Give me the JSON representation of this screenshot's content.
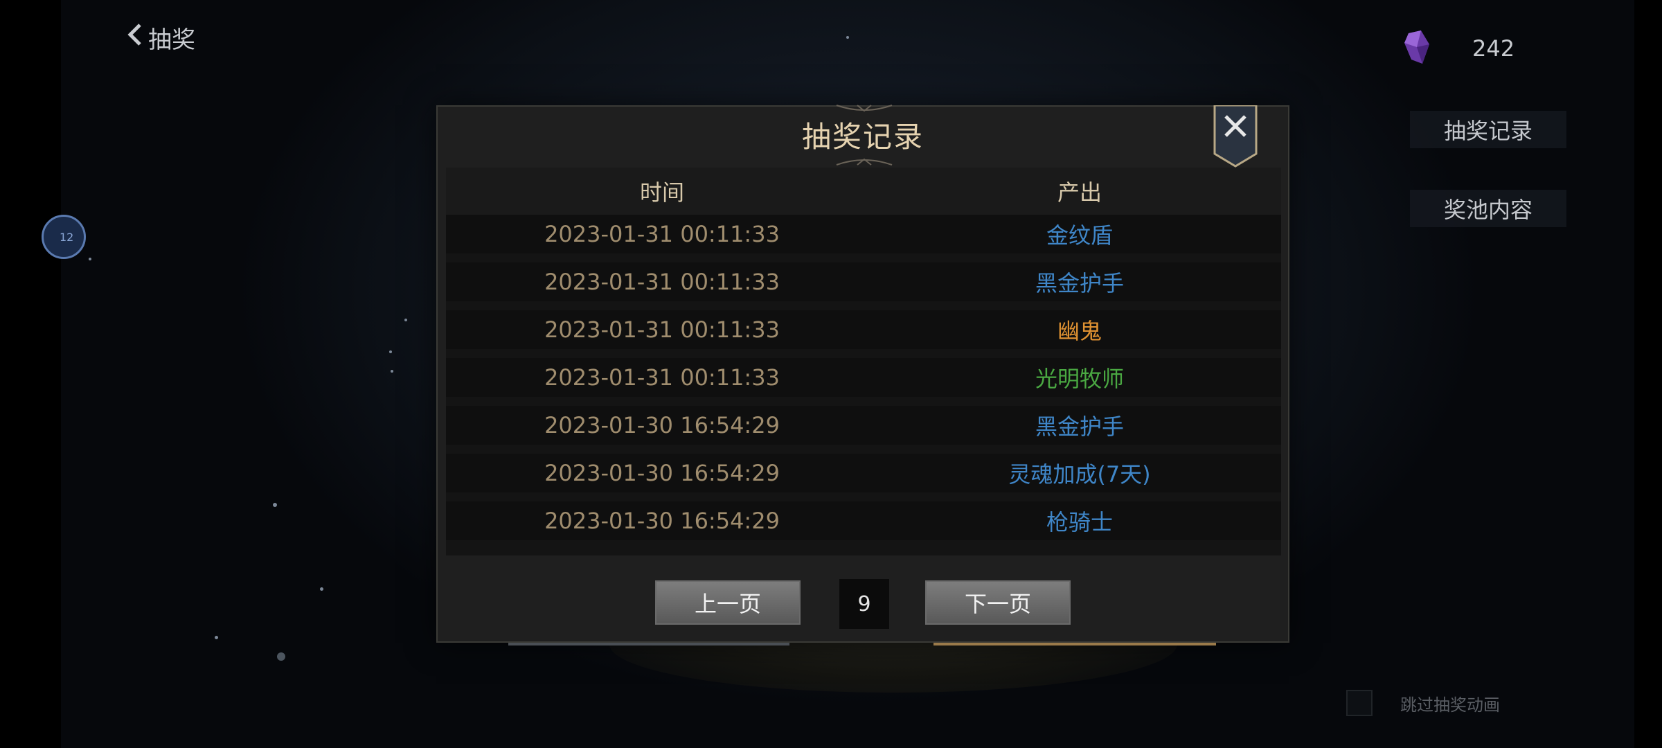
{
  "header": {
    "back_label": "抽奖",
    "currency_value": "242"
  },
  "side": {
    "record_label": "抽奖记录",
    "pool_label": "奖池内容",
    "circle_label": "12"
  },
  "skip": {
    "label": "跳过抽奖动画",
    "checked": false
  },
  "dialog": {
    "title": "抽奖记录",
    "columns": [
      "时间",
      "产出"
    ],
    "rows": [
      {
        "time": "2023-01-31 00:11:33",
        "item": "金纹盾",
        "color": "#3f86c8"
      },
      {
        "time": "2023-01-31 00:11:33",
        "item": "黑金护手",
        "color": "#3f86c8"
      },
      {
        "time": "2023-01-31 00:11:33",
        "item": "幽鬼",
        "color": "#e09232"
      },
      {
        "time": "2023-01-31 00:11:33",
        "item": "光明牧师",
        "color": "#4aa842"
      },
      {
        "time": "2023-01-30 16:54:29",
        "item": "黑金护手",
        "color": "#3f86c8"
      },
      {
        "time": "2023-01-30 16:54:29",
        "item": "灵魂加成(7天)",
        "color": "#3f86c8"
      },
      {
        "time": "2023-01-30 16:54:29",
        "item": "枪骑士",
        "color": "#3f86c8"
      }
    ],
    "pager": {
      "prev_label": "上一页",
      "page": "9",
      "next_label": "下一页"
    }
  },
  "colors": {
    "title": "#e6d3b0",
    "time_text": "#a08d6e",
    "rarity_blue": "#3f86c8",
    "rarity_orange": "#e09232",
    "rarity_green": "#4aa842"
  },
  "icons": [
    "chevron-left-icon",
    "purple-crystal-icon",
    "close-icon"
  ]
}
